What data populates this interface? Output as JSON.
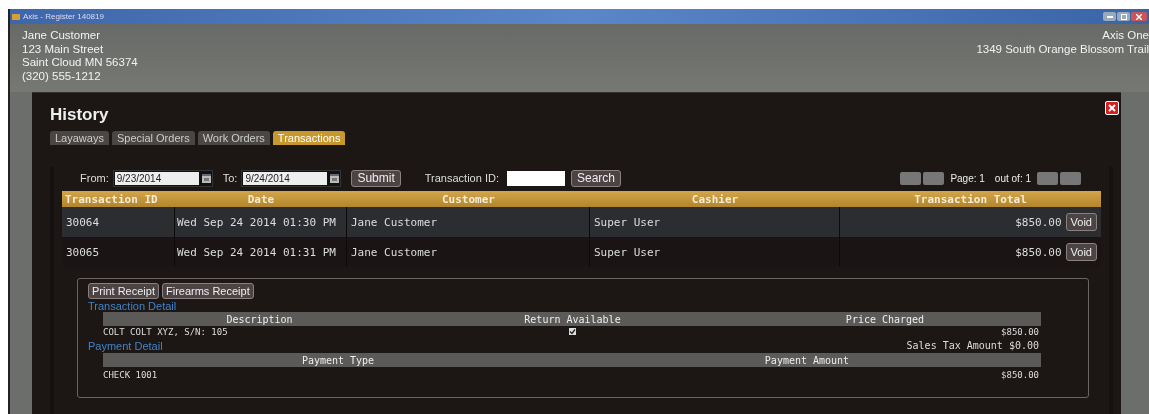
{
  "window": {
    "title": "Axis - Register 140819"
  },
  "customer": {
    "lines": [
      "Jane Customer",
      "123 Main Street",
      "Saint Cloud MN 56374",
      "(320) 555-1212"
    ]
  },
  "store": {
    "lines": [
      "Axis One",
      "1349 South Orange Blossom Trail"
    ]
  },
  "dialog": {
    "title": "History",
    "tabs": [
      {
        "label": "Layaways",
        "selected": false
      },
      {
        "label": "Special Orders",
        "selected": false
      },
      {
        "label": "Work Orders",
        "selected": false
      },
      {
        "label": "Transactions",
        "selected": true
      }
    ],
    "filters": {
      "from_label": "From:",
      "from_value": "9/23/2014",
      "to_label": "To:",
      "to_value": "9/24/2014",
      "submit": "Submit",
      "id_label": "Transaction ID:",
      "search": "Search"
    },
    "pager": {
      "page_label": "Page:",
      "page": "1",
      "out_of_label": "out of:",
      "total": "1"
    },
    "table": {
      "columns": [
        "Transaction ID",
        "Date",
        "Customer",
        "Cashier",
        "Transaction Total"
      ],
      "rows": [
        {
          "id": "30064",
          "date": "Wed Sep 24 2014 01:30 PM",
          "customer": "Jane Customer",
          "cashier": "Super User",
          "total": "$850.00",
          "action": "Void",
          "selected": true
        },
        {
          "id": "30065",
          "date": "Wed Sep 24 2014 01:31 PM",
          "customer": "Jane Customer",
          "cashier": "Super User",
          "total": "$850.00",
          "action": "Void",
          "selected": false
        }
      ]
    },
    "detail": {
      "buttons": [
        "Print Receipt",
        "Firearms Receipt"
      ],
      "transaction_heading": "Transaction Detail",
      "item_columns": [
        "Description",
        "Return Available",
        "Price Charged"
      ],
      "items": [
        {
          "description": "COLT COLT XYZ, S/N: 105",
          "return_available": true,
          "price": "$850.00"
        }
      ],
      "tax_label": "Sales Tax Amount",
      "tax_value": "$0.00",
      "payment_heading": "Payment Detail",
      "payment_columns": [
        "Payment Type",
        "Payment Amount"
      ],
      "payments": [
        {
          "type": "CHECK 1001",
          "amount": "$850.00"
        }
      ]
    }
  }
}
